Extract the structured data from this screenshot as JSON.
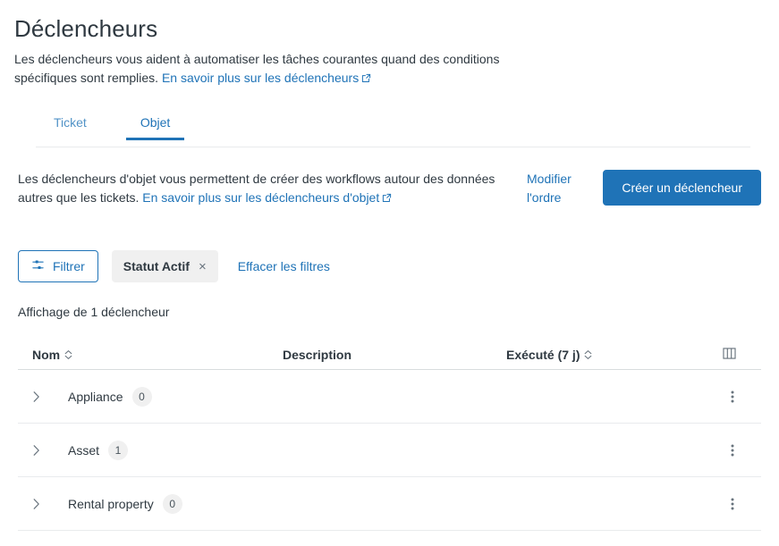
{
  "header": {
    "title": "Déclencheurs",
    "description_part1": "Les déclencheurs vous aident à automatiser les tâches courantes quand des conditions spécifiques sont remplies.",
    "description_link": "En savoir plus sur les déclencheurs"
  },
  "tabs": [
    {
      "label": "Ticket",
      "active": false
    },
    {
      "label": "Objet",
      "active": true
    }
  ],
  "intro": {
    "text_part1": "Les déclencheurs d'objet vous permettent de créer des workflows autour des données autres que les tickets.",
    "text_link": "En savoir plus sur les déclencheurs d'objet",
    "reorder_label": "Modifier l'ordre",
    "create_button_label": "Créer un déclencheur"
  },
  "filters": {
    "filter_button_label": "Filtrer",
    "chip_label": "Statut Actif",
    "chip_remove_label": "×",
    "clear_filters_label": "Effacer les filtres"
  },
  "result_count": "Affichage de 1 déclencheur",
  "table": {
    "columns": {
      "name": "Nom",
      "description": "Description",
      "executed": "Exécuté (7 j)"
    },
    "rows": [
      {
        "name": "Appliance",
        "count": "0",
        "description": "",
        "executed": ""
      },
      {
        "name": "Asset",
        "count": "1",
        "description": "",
        "executed": ""
      },
      {
        "name": "Rental property",
        "count": "0",
        "description": "",
        "executed": ""
      }
    ]
  },
  "colors": {
    "accent": "#1f73b7",
    "text": "#2f3941",
    "muted": "#68737d",
    "border": "#e9ebed",
    "chip_bg": "#f0f0f0"
  }
}
